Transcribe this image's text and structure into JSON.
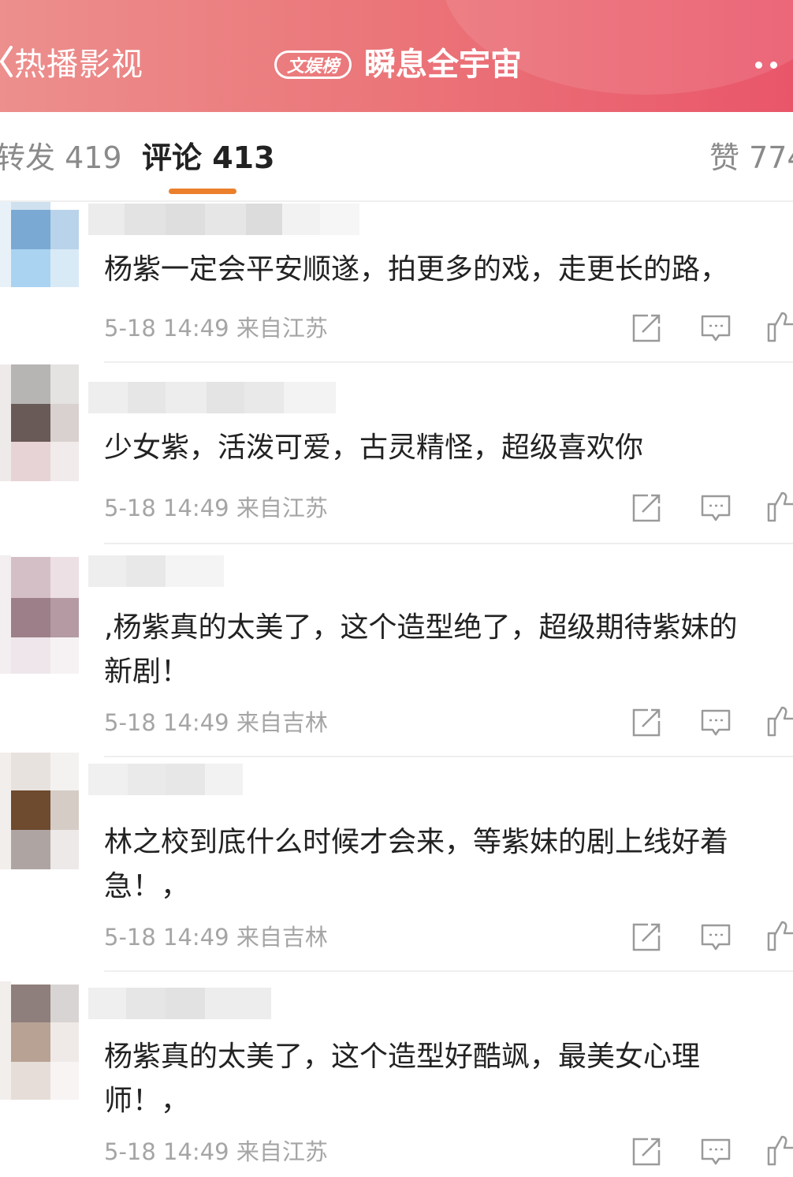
{
  "header": {
    "title": "热播影视",
    "badge": "文娱榜",
    "topic": "瞬息全宇宙"
  },
  "tabs": {
    "repost": "转发 419",
    "comments": "评论 413",
    "likes": "赞 774"
  },
  "colors": {
    "header_gradient_start": "#ec8f8d",
    "header_gradient_end": "#e9566a",
    "tab_underline": "#eb7f2b",
    "meta_text": "#a5a5a5"
  },
  "comments": [
    {
      "lines": [
        "杨紫一定会平安顺遂，拍更多的戏，走更长的路，"
      ],
      "time": "5-18 14:49",
      "source": "来自江苏"
    },
    {
      "lines": [
        "少女紫，活泼可爱，古灵精怪，超级喜欢你"
      ],
      "time": "5-18 14:49",
      "source": "来自江苏"
    },
    {
      "lines": [
        ",杨紫真的太美了，这个造型绝了，超级期待紫妹的",
        "新剧！"
      ],
      "time": "5-18 14:49",
      "source": "来自吉林"
    },
    {
      "lines": [
        "林之校到底什么时候才会来，等紫妹的剧上线好着",
        "急！，"
      ],
      "time": "5-18 14:49",
      "source": "来自吉林"
    },
    {
      "lines": [
        "杨紫真的太美了，这个造型好酷飒，最美女心理",
        "师！，"
      ],
      "time": "5-18 14:49",
      "source": "来自江苏"
    }
  ]
}
